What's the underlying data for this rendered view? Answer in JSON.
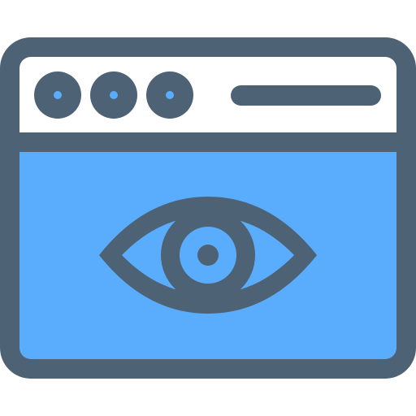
{
  "icon": {
    "name": "browser-window-eye-icon",
    "colors": {
      "outline": "#4d6275",
      "titlebar": "#ffffff",
      "content": "#5aadfc",
      "dot_center": "#5aadfc",
      "background": "#ffffff"
    },
    "window_controls": [
      {
        "icon_name": "window-control-dot-icon"
      },
      {
        "icon_name": "window-control-dot-icon"
      },
      {
        "icon_name": "window-control-dot-icon"
      }
    ],
    "address_bar": {
      "icon_name": "address-bar-icon"
    },
    "view": {
      "icon_name": "eye-icon"
    }
  }
}
